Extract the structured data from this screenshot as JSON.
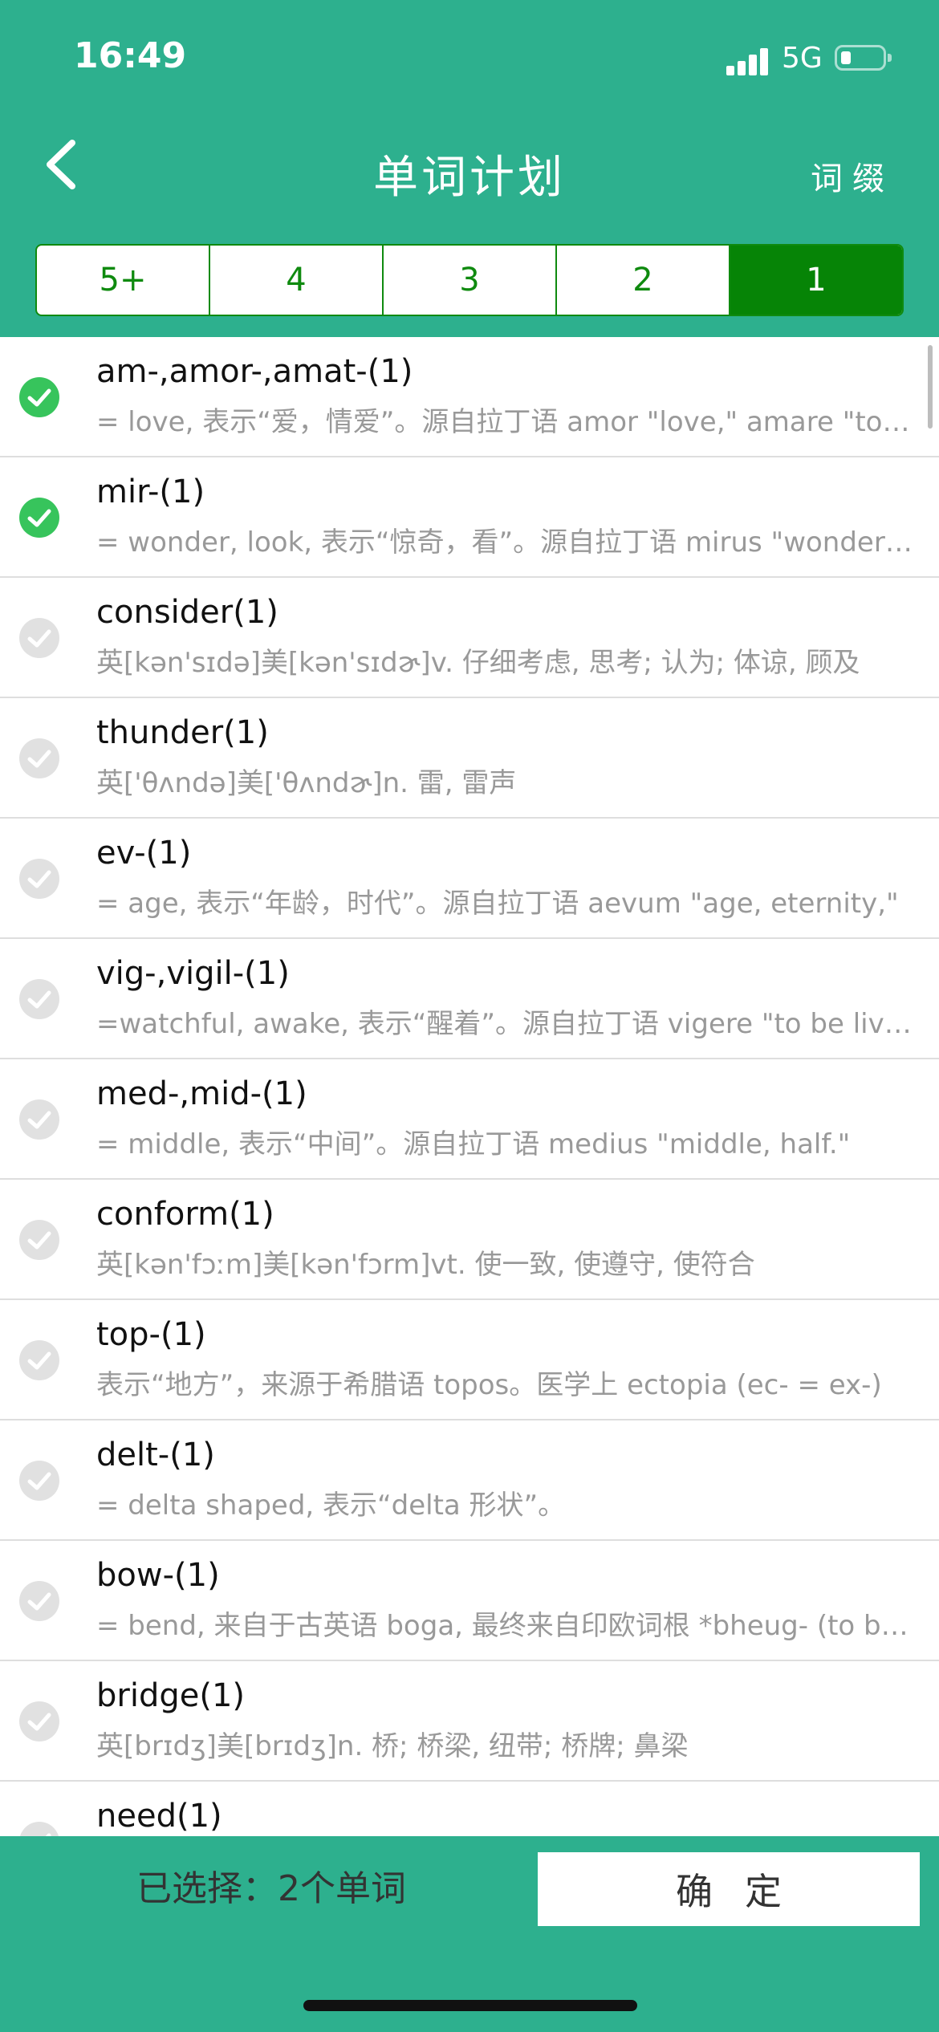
{
  "status": {
    "time": "16:49",
    "network": "5G"
  },
  "header": {
    "title": "单词计划",
    "right_link": "词缀"
  },
  "tabs": [
    {
      "label": "5+",
      "active": false
    },
    {
      "label": "4",
      "active": false
    },
    {
      "label": "3",
      "active": false
    },
    {
      "label": "2",
      "active": false
    },
    {
      "label": "1",
      "active": true
    }
  ],
  "items": [
    {
      "word": "am-,amor-,amat-(1)",
      "desc": "= love, 表示“爱，情爱”。源自拉丁语 amor \"love,\" amare \"to love\"",
      "checked": true
    },
    {
      "word": "mir-(1)",
      "desc": "= wonder, look, 表示“惊奇，看”。源自拉丁语 mirus \"wonderful\"",
      "checked": true
    },
    {
      "word": "consider(1)",
      "desc": "英[kən'sɪdə]美[kən'sɪdɚ]v. 仔细考虑, 思考; 认为; 体谅, 顾及",
      "checked": false
    },
    {
      "word": "thunder(1)",
      "desc": "英['θʌndə]美['θʌndɚ]n. 雷, 雷声",
      "checked": false
    },
    {
      "word": "ev-(1)",
      "desc": "= age, 表示“年龄，时代”。源自拉丁语 aevum \"age, eternity,\"",
      "checked": false
    },
    {
      "word": "vig-,vigil-(1)",
      "desc": "=watchful, awake, 表示“醒着”。源自拉丁语 vigere \"to be lively\"",
      "checked": false
    },
    {
      "word": "med-,mid-(1)",
      "desc": "= middle, 表示“中间”。源自拉丁语 medius \"middle, half.\"",
      "checked": false
    },
    {
      "word": "conform(1)",
      "desc": "英[kən'fɔːm]美[kən'fɔrm]vt. 使一致, 使遵守, 使符合",
      "checked": false
    },
    {
      "word": "top-(1)",
      "desc": "表示“地方”，来源于希腊语 topos。医学上 ectopia (ec- = ex-)",
      "checked": false
    },
    {
      "word": "delt-(1)",
      "desc": "= delta shaped, 表示“delta 形状”。",
      "checked": false
    },
    {
      "word": "bow-(1)",
      "desc": "= bend, 来自于古英语 boga, 最终来自印欧词根 *bheug- (to bend)",
      "checked": false
    },
    {
      "word": "bridge(1)",
      "desc": "英[brɪdʒ]美[brɪdʒ]n. 桥; 桥梁, 纽带; 桥牌; 鼻梁",
      "checked": false
    },
    {
      "word": "need(1)",
      "desc": "",
      "checked": false
    }
  ],
  "footer": {
    "selected_text": "已选择：2个单词",
    "confirm_label": "确定"
  },
  "colors": {
    "primary": "#2db08e",
    "tab_active": "#068406",
    "check_on": "#37c45c",
    "check_off": "#e1e1e1"
  },
  "icons": {
    "back": "chevron-left-icon",
    "item_check": "check-circle-icon"
  }
}
